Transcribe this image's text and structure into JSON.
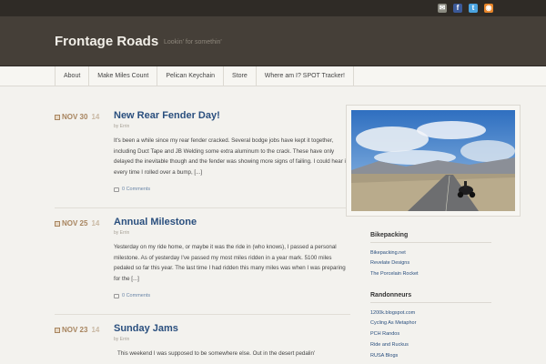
{
  "social": {
    "mail": "✉",
    "facebook": "f",
    "twitter": "t",
    "rss": "◉"
  },
  "site": {
    "title": "Frontage Roads",
    "tagline": "Lookin' for somethin'"
  },
  "nav": [
    "About",
    "Make Miles Count",
    "Pelican Keychain",
    "Store",
    "Where am I? SPOT Tracker!"
  ],
  "posts": [
    {
      "month_day": "NOV 30",
      "year": "14",
      "title": "New Rear Fender Day!",
      "author": "by Errin",
      "excerpt": "It's been a while since my rear fender cracked. Several bodge jobs have kept it together, including Duct Tape and JB Welding some extra aluminum to the crack. These have only delayed the inevitable though and the fender was showing more signs of failing. I could hear it every time I rolled over a bump, [...]",
      "comments": "0 Comments"
    },
    {
      "month_day": "NOV 25",
      "year": "14",
      "title": "Annual Milestone",
      "author": "by Errin",
      "excerpt": "Yesterday on my ride home, or maybe it was the ride in (who knows), I passed a personal milestone. As of yesterday I've passed my most miles ridden in a year mark. 5100 miles pedaled so far this year. The last time I had ridden this many miles was when I was preparing for the [...]",
      "comments": "0 Comments"
    },
    {
      "month_day": "NOV 23",
      "year": "14",
      "title": "Sunday Jams",
      "author": "by Errin",
      "excerpt": "This weekend I was supposed to be somewhere else. Out in the desert pedalin'"
    }
  ],
  "sidebar": {
    "bikepacking": {
      "title": "Bikepacking",
      "links": [
        "Bikepacking.net",
        "Revelate Designs",
        "The Porcelain Rocket"
      ]
    },
    "randonneurs": {
      "title": "Randonneurs",
      "links": [
        "1200k.blogspot.com",
        "Cycling As Metaphor",
        "PCH Randos",
        "Ride and Ruckus",
        "RUSA Blogs"
      ]
    }
  },
  "colors": {
    "accent": "#2a4f7e",
    "date": "#a7845e",
    "header": "#453f38"
  }
}
